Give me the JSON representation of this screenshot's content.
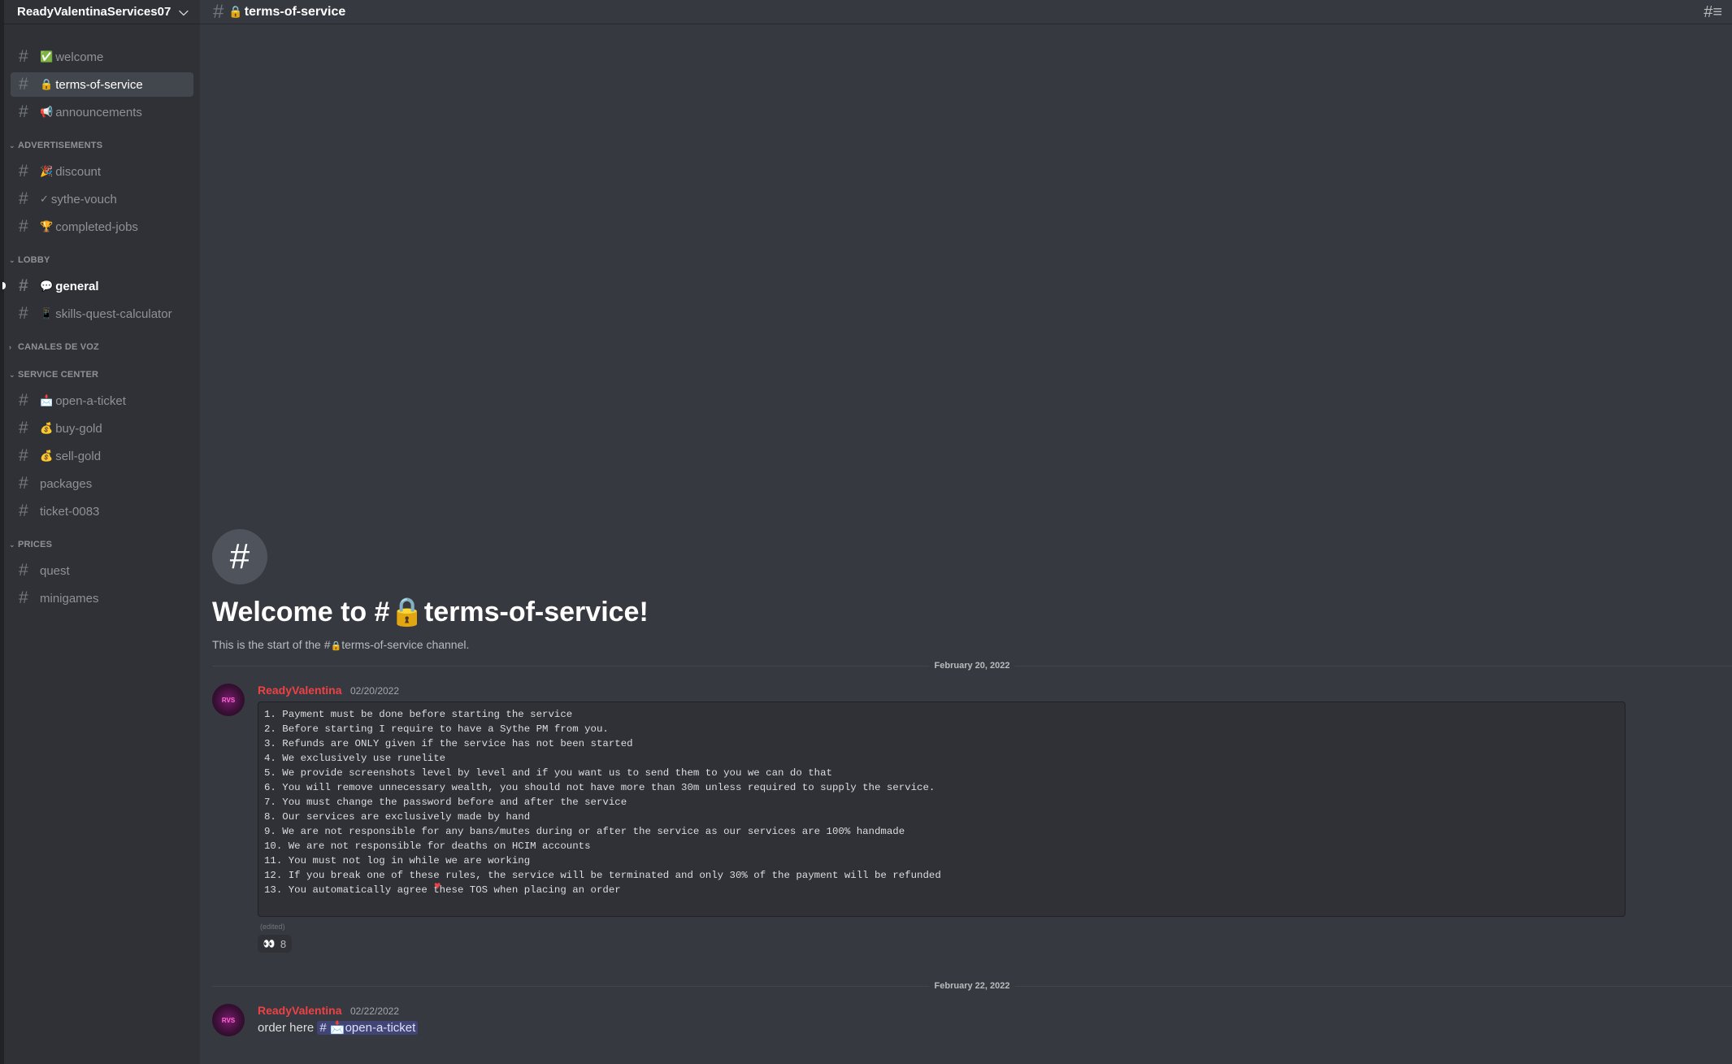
{
  "server": {
    "name": "ReadyValentinaServices07"
  },
  "sidebar": {
    "top_channels": [
      {
        "emoji": "✅",
        "label": "welcome"
      },
      {
        "emoji": "🔒",
        "label": "terms-of-service"
      },
      {
        "emoji": "📢",
        "label": "announcements"
      }
    ],
    "categories": {
      "advertisements": {
        "label": "ADVERTISEMENTS",
        "channels": [
          {
            "emoji": "🎉",
            "label": "discount"
          },
          {
            "emoji": "✓",
            "label": "sythe-vouch"
          },
          {
            "emoji": "🏆",
            "label": "completed-jobs"
          }
        ]
      },
      "lobby": {
        "label": "LOBBY",
        "channels": [
          {
            "emoji": "💬",
            "label": "general"
          },
          {
            "emoji": "📱",
            "label": "skills-quest-calculator"
          }
        ]
      },
      "voice": {
        "label": "CANALES DE VOZ"
      },
      "service_center": {
        "label": "SERVICE CENTER",
        "channels": [
          {
            "emoji": "📩",
            "label": "open-a-ticket"
          },
          {
            "emoji": "💰",
            "label": "buy-gold"
          },
          {
            "emoji": "💰",
            "label": "sell-gold"
          },
          {
            "emoji": "",
            "label": "packages"
          },
          {
            "emoji": "",
            "label": "ticket-0083"
          }
        ]
      },
      "prices": {
        "label": "PRICES",
        "channels": [
          {
            "emoji": "",
            "label": "quest"
          },
          {
            "emoji": "",
            "label": "minigames"
          }
        ]
      }
    }
  },
  "topbar": {
    "channel_emoji": "🔒",
    "channel_name": "terms-of-service"
  },
  "welcome": {
    "title_prefix": "Welcome to #",
    "title_emoji": "🔒",
    "title_channel": "terms-of-service!",
    "sub_prefix": "This is the start of the #",
    "sub_emoji": "🔒",
    "sub_suffix": "terms-of-service channel."
  },
  "dividers": {
    "first": "February 20, 2022",
    "second": "February 22, 2022"
  },
  "messages": [
    {
      "author": "ReadyValentina",
      "timestamp": "02/20/2022",
      "code": "1. Payment must be done before starting the service\n2. Before starting I require to have a Sythe PM from you.\n3. Refunds are ONLY given if the service has not been started\n4. We exclusively use runelite\n5. We provide screenshots level by level and if you want us to send them to you we can do that\n6. You will remove unnecessary wealth, you should not have more than 30m unless required to supply the service.\n7. You must change the password before and after the service\n8. Our services are exclusively made by hand\n9. We are not responsible for any bans/mutes during or after the service as our services are 100% handmade\n10. We are not responsible for deaths on HCIM accounts\n11. You must not log in while we are working\n12. If you break one of these rules, the service will be terminated and only 30% of the payment will be refunded\n13. You automatically agree these TOS when placing an order",
      "heart": "♥",
      "edited": "(edited)",
      "reaction_emoji": "👀",
      "reaction_count": "8"
    },
    {
      "author": "ReadyValentina",
      "timestamp": "02/22/2022",
      "text": "order here",
      "mention_hash": "#",
      "mention_emoji": "📩",
      "mention_label": "open-a-ticket"
    }
  ]
}
